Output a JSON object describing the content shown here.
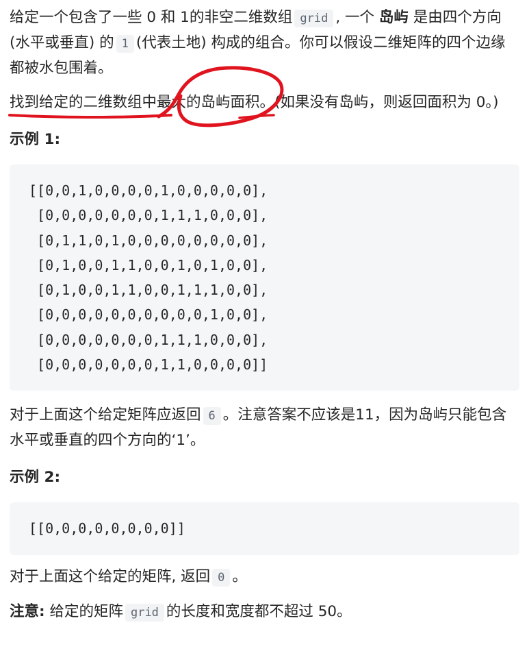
{
  "intro": {
    "part1": "给定一个包含了一些 0 和 1的非空二维数组",
    "code_grid": "grid",
    "part2": ", 一个",
    "bold_island": "岛屿",
    "part3": "是由四个方向 (水平或垂直) 的",
    "code_one": "1",
    "part4": "(代表土地) 构成的组合。你可以假设二维矩阵的四个边缘都被水包围着。"
  },
  "task": {
    "text": "找到给定的二维数组中最大的岛屿面积。(如果没有岛屿，则返回面积为 0。)"
  },
  "example1": {
    "heading": "示例 1:",
    "grid_rows": [
      "[[0,0,1,0,0,0,0,1,0,0,0,0,0],",
      " [0,0,0,0,0,0,0,1,1,1,0,0,0],",
      " [0,1,1,0,1,0,0,0,0,0,0,0,0],",
      " [0,1,0,0,1,1,0,0,1,0,1,0,0],",
      " [0,1,0,0,1,1,0,0,1,1,1,0,0],",
      " [0,0,0,0,0,0,0,0,0,0,1,0,0],",
      " [0,0,0,0,0,0,0,1,1,1,0,0,0],",
      " [0,0,0,0,0,0,0,1,1,0,0,0,0]]"
    ],
    "explain_part1": "对于上面这个给定矩阵应返回",
    "answer": "6",
    "explain_part2": "。注意答案不应该是11，因为岛屿只能包含水平或垂直的四个方向的‘1’。"
  },
  "example2": {
    "heading": "示例 2:",
    "grid_rows": [
      "[[0,0,0,0,0,0,0,0]]"
    ],
    "explain_part1": "对于上面这个给定的矩阵, 返回",
    "answer": "0",
    "explain_part2": "。"
  },
  "note": {
    "label": "注意:",
    "part1": "给定的矩阵",
    "code_grid": "grid",
    "part2": "的长度和宽度都不超过 50。"
  },
  "colors": {
    "annotation": "#e0141e",
    "code_bg": "#f5f6f8",
    "text": "#262626"
  }
}
